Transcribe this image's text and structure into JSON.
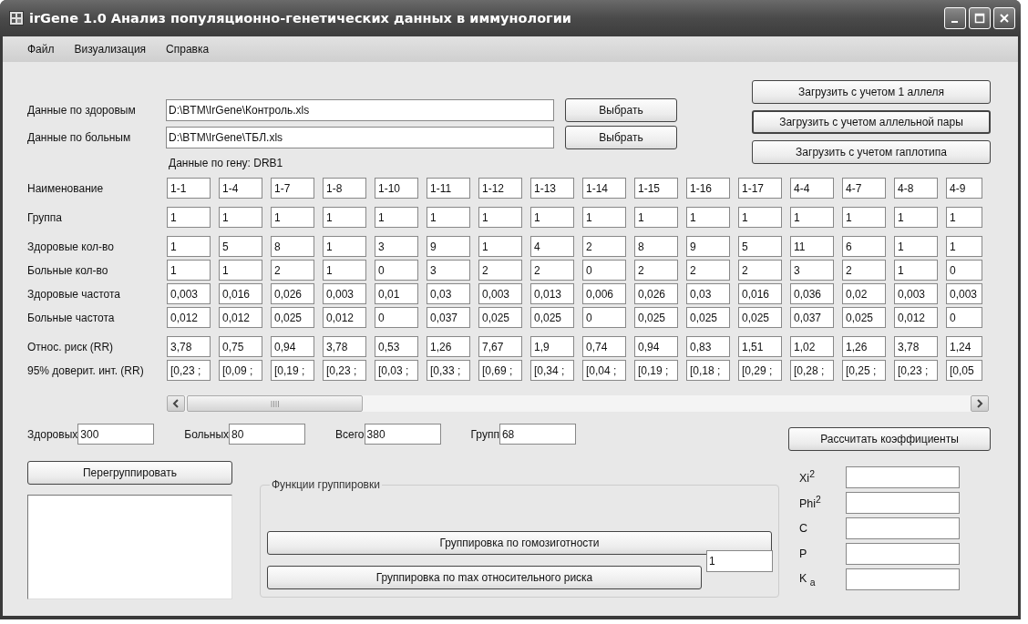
{
  "window": {
    "title": "irGene 1.0 Анализ популяционно-генетических данных в иммунологии"
  },
  "menu": [
    "Файл",
    "Визуализация",
    "Справка"
  ],
  "files": [
    {
      "label": "Данные по здоровым",
      "value": "D:\\BTM\\IrGene\\Контроль.xls",
      "button": "Выбрать"
    },
    {
      "label": "Данные по больным",
      "value": "D:\\BTM\\IrGene\\ТБЛ.xls",
      "button": "Выбрать"
    }
  ],
  "gene_label": "Данные по гену: DRB1",
  "load_buttons": [
    "Загрузить с учетом 1 аллеля",
    "Загрузить с учетом аллельной пары",
    "Загрузить с учетом гаплотипа"
  ],
  "grid": {
    "rows": [
      {
        "label": "Наименование",
        "cells": [
          "1-1",
          "1-4",
          "1-7",
          "1-8",
          "1-10",
          "1-11",
          "1-12",
          "1-13",
          "1-14",
          "1-15",
          "1-16",
          "1-17",
          "4-4",
          "4-7",
          "4-8",
          "4-9"
        ]
      },
      {
        "label": "Группа",
        "cells": [
          "1",
          "1",
          "1",
          "1",
          "1",
          "1",
          "1",
          "1",
          "1",
          "1",
          "1",
          "1",
          "1",
          "1",
          "1",
          "1"
        ]
      },
      {
        "label": "Здоровые кол-во",
        "cells": [
          "1",
          "5",
          "8",
          "1",
          "3",
          "9",
          "1",
          "4",
          "2",
          "8",
          "9",
          "5",
          "11",
          "6",
          "1",
          "1"
        ]
      },
      {
        "label": "Больные кол-во",
        "cells": [
          "1",
          "1",
          "2",
          "1",
          "0",
          "3",
          "2",
          "2",
          "0",
          "2",
          "2",
          "2",
          "3",
          "2",
          "1",
          "0"
        ]
      },
      {
        "label": "Здоровые частота",
        "cells": [
          "0,003",
          "0,016",
          "0,026",
          "0,003",
          "0,01",
          "0,03",
          "0,003",
          "0,013",
          "0,006",
          "0,026",
          "0,03",
          "0,016",
          "0,036",
          "0,02",
          "0,003",
          "0,003"
        ]
      },
      {
        "label": "Больные частота",
        "cells": [
          "0,012",
          "0,012",
          "0,025",
          "0,012",
          "0",
          "0,037",
          "0,025",
          "0,025",
          "0",
          "0,025",
          "0,025",
          "0,025",
          "0,037",
          "0,025",
          "0,012",
          "0"
        ]
      },
      {
        "label": "Относ. риск (RR)",
        "cells": [
          "3,78",
          "0,75",
          "0,94",
          "3,78",
          "0,53",
          "1,26",
          "7,67",
          "1,9",
          "0,74",
          "0,94",
          "0,83",
          "1,51",
          "1,02",
          "1,26",
          "3,78",
          "1,24"
        ]
      },
      {
        "label": "95% доверит. инт. (RR)",
        "cells": [
          "[0,23 ;",
          "[0,09 ;",
          "[0,19 ;",
          "[0,23 ;",
          "[0,03 ;",
          "[0,33 ;",
          "[0,69 ;",
          "[0,34 ;",
          "[0,04 ;",
          "[0,19 ;",
          "[0,18 ;",
          "[0,29 ;",
          "[0,28 ;",
          "[0,25 ;",
          "[0,23 ;",
          "[0,05"
        ]
      }
    ]
  },
  "totals": [
    {
      "label": "Здоровых",
      "value": "300"
    },
    {
      "label": "Больных",
      "value": "80"
    },
    {
      "label": "Всего",
      "value": "380"
    },
    {
      "label": "Групп",
      "value": "68"
    }
  ],
  "regroup_button": "Перегруппировать",
  "grouping": {
    "title": "Функции группировки",
    "buttons": [
      "Группировка по гомозиготности",
      "Группировка по max относительного риска"
    ],
    "threshold": "1"
  },
  "coefficients": {
    "button": "Рассчитать коэффициенты",
    "items": [
      {
        "label": "Xi$^{2}$"
      },
      {
        "label": "Phi$^{2}$"
      },
      {
        "label": "C"
      },
      {
        "label": "P"
      },
      {
        "label": "K $_{a}$"
      }
    ]
  }
}
